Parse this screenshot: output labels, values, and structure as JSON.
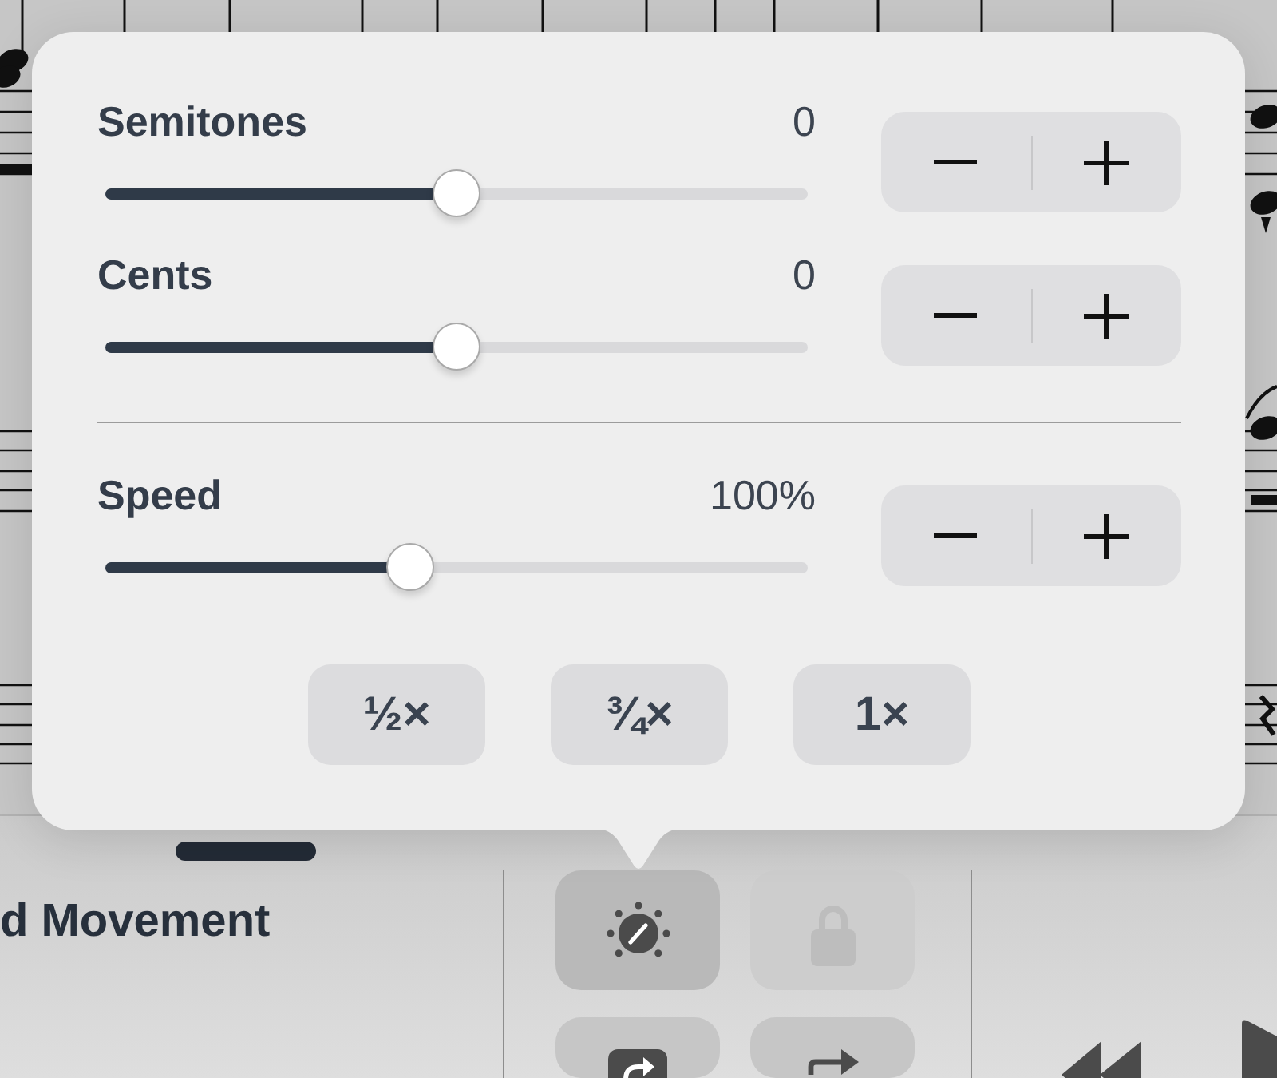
{
  "popover": {
    "sections": [
      {
        "sliders": [
          {
            "label": "Semitones",
            "value": "0",
            "level": 0.5
          },
          {
            "label": "Cents",
            "value": "0",
            "level": 0.5
          }
        ]
      },
      {
        "sliders": [
          {
            "label": "Speed",
            "value": "100%",
            "level": 0.434
          }
        ],
        "presets": [
          "½×",
          "¾×",
          "1×"
        ]
      }
    ]
  },
  "toolbar": {
    "title": "d Movement",
    "tool_buttons": [
      {
        "kind": "tune",
        "selected": true,
        "disabled": false
      },
      {
        "kind": "lock",
        "selected": false,
        "disabled": true
      },
      {
        "kind": "loop",
        "selected": false,
        "disabled": false
      },
      {
        "kind": "redo",
        "selected": false,
        "disabled": false
      }
    ]
  }
}
